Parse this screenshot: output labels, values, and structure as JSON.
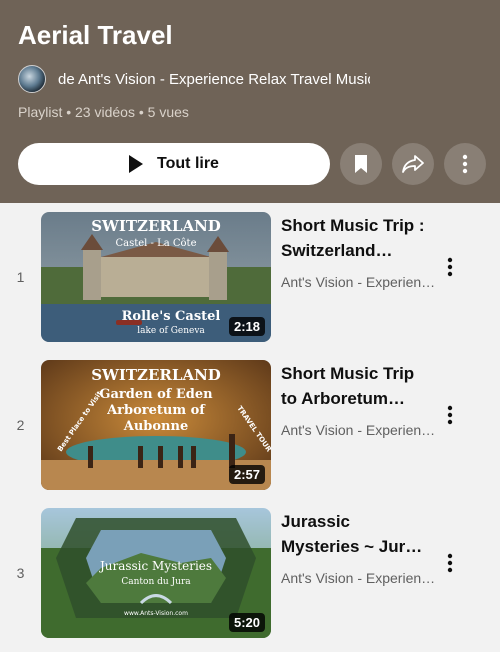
{
  "playlist": {
    "title": "Aerial Travel",
    "channel": "de Ant's Vision - Experience Relax Travel Music Trip",
    "meta": "Playlist • 23 vidéos • 5 vues"
  },
  "actions": {
    "play_all_label": "Tout lire",
    "save_icon": "bookmark-icon",
    "share_icon": "share-icon",
    "more_icon": "more-vert-icon"
  },
  "items": [
    {
      "index": "1",
      "title_line1": "Short Music Trip :",
      "title_line2": "Switzerland…",
      "channel": "Ant's Vision - Experien…",
      "duration": "2:18",
      "thumb_text": {
        "top": "SWITZERLAND",
        "sub": "Castel - La Côte",
        "bottom": "Rolle's Castel",
        "bottom_sub": "lake of Geneva"
      }
    },
    {
      "index": "2",
      "title_line1": "Short Music Trip",
      "title_line2": "to Arboretum…",
      "channel": "Ant's Vision - Experien…",
      "duration": "2:57",
      "thumb_text": {
        "top": "SWITZERLAND",
        "line2": "Garden of Eden",
        "line3": "Arboretum of",
        "line4": "Aubonne",
        "badge_left": "Best Place to Visit",
        "badge_right": "TRAVEL TOUR"
      }
    },
    {
      "index": "3",
      "title_line1": "Jurassic",
      "title_line2": "Mysteries ~ Jur…",
      "channel": "Ant's Vision - Experien…",
      "duration": "5:20",
      "thumb_text": {
        "title": "Jurassic Mysteries",
        "sub": "Canton du Jura",
        "url": "www.Ants-Vision.com"
      }
    }
  ],
  "colors": {
    "header_bg": "#6f6357",
    "page_bg": "#f2f2f2",
    "text_primary": "#0f0f0f",
    "text_secondary": "#606060"
  }
}
